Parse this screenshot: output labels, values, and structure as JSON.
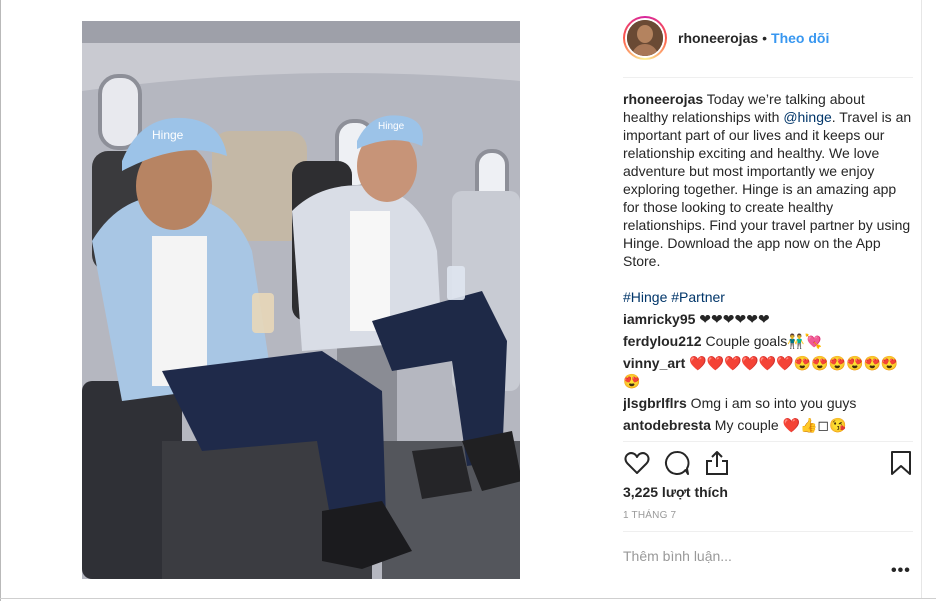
{
  "post": {
    "username": "rhoneerojas",
    "follow_label": "Theo dõi",
    "separator": "•",
    "photo_alt": "Two men in blue Hinge caps sitting on an airplane"
  },
  "caption": {
    "author": "rhoneerojas",
    "text_before_mention": " Today we’re talking about healthy relationships with ",
    "mention": "@hinge",
    "text_after_mention": ". Travel is an important part of our lives and it keeps our relationship exciting and healthy. We love adventure but most importantly we enjoy exploring together. Hinge is an amazing app for those looking to create healthy relationships. Find your travel partner by using Hinge. Download the app now on the App Store.",
    "hashtag_1": "#Hinge",
    "hashtag_2": "#Partner"
  },
  "photo_text": {
    "cap_brand": "Hinge"
  },
  "comments": [
    {
      "user": "iamricky95",
      "text": " ❤❤❤❤❤❤"
    },
    {
      "user": "ferdylou212",
      "text": " Couple goals👬💘"
    },
    {
      "user": "vinny_art",
      "text": " ❤️❤️❤️❤️❤️❤️😍😍😍😍😍😍😍"
    },
    {
      "user": "jlsgbrlflrs",
      "text": " Omg i am so into you guys"
    },
    {
      "user": "antodebresta",
      "text": " My couple ❤️👍◻😘"
    }
  ],
  "actions": {
    "like_icon": "heart-icon",
    "comment_icon": "comment-icon",
    "share_icon": "share-icon",
    "save_icon": "bookmark-icon"
  },
  "stats": {
    "likes": "3,225 lượt thích",
    "date": "1 THÁNG 7"
  },
  "composer": {
    "placeholder": "Thêm bình luận...",
    "more_label": "•••"
  },
  "colors": {
    "accent": "#3897f0",
    "mention": "#003569",
    "muted": "#999999",
    "text": "#262626"
  }
}
